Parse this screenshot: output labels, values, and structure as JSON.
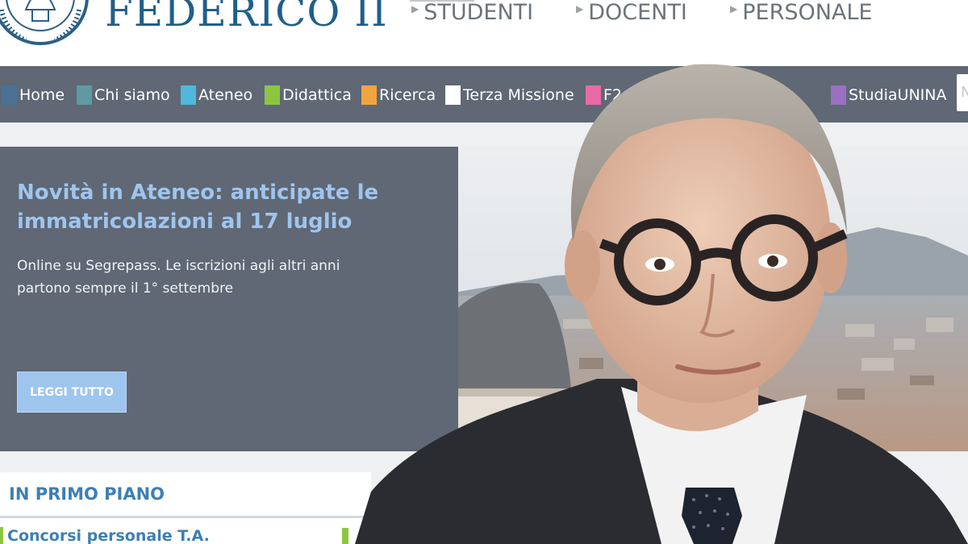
{
  "header": {
    "brand": "FEDERICO II",
    "seal_icon": "university-seal-icon",
    "top_nav": [
      "STUDENTI",
      "DOCENTI",
      "PERSONALE"
    ]
  },
  "nav": {
    "items": [
      {
        "label": "Home",
        "color": "#4a7194"
      },
      {
        "label": "Chi siamo",
        "color": "#5f9aa2"
      },
      {
        "label": "Ateneo",
        "color": "#4fb8dc"
      },
      {
        "label": "Didattica",
        "color": "#8cc63f"
      },
      {
        "label": "Ricerca",
        "color": "#f4a43d"
      },
      {
        "label": "Terza Missione",
        "color": "#ffffff"
      },
      {
        "label": "F2",
        "color": "#e86aa6"
      },
      {
        "label": "StudiaUNINA",
        "color": "#9b70c2"
      }
    ],
    "search_placeholder": "N"
  },
  "hero": {
    "title": "Novità in Ateneo: anticipate le immatricolazioni al 17 luglio",
    "text": "Online su Segrepass. Le iscrizioni agli altri anni partono sempre il 1° settembre",
    "button": "LEGGI TUTTO"
  },
  "section": {
    "title": "IN PRIMO PIANO",
    "items": [
      "Concorsi personale T.A."
    ]
  },
  "colors": {
    "navbar": "#5f6874",
    "accent": "#9ec5ee",
    "link": "#3d7fb3"
  }
}
